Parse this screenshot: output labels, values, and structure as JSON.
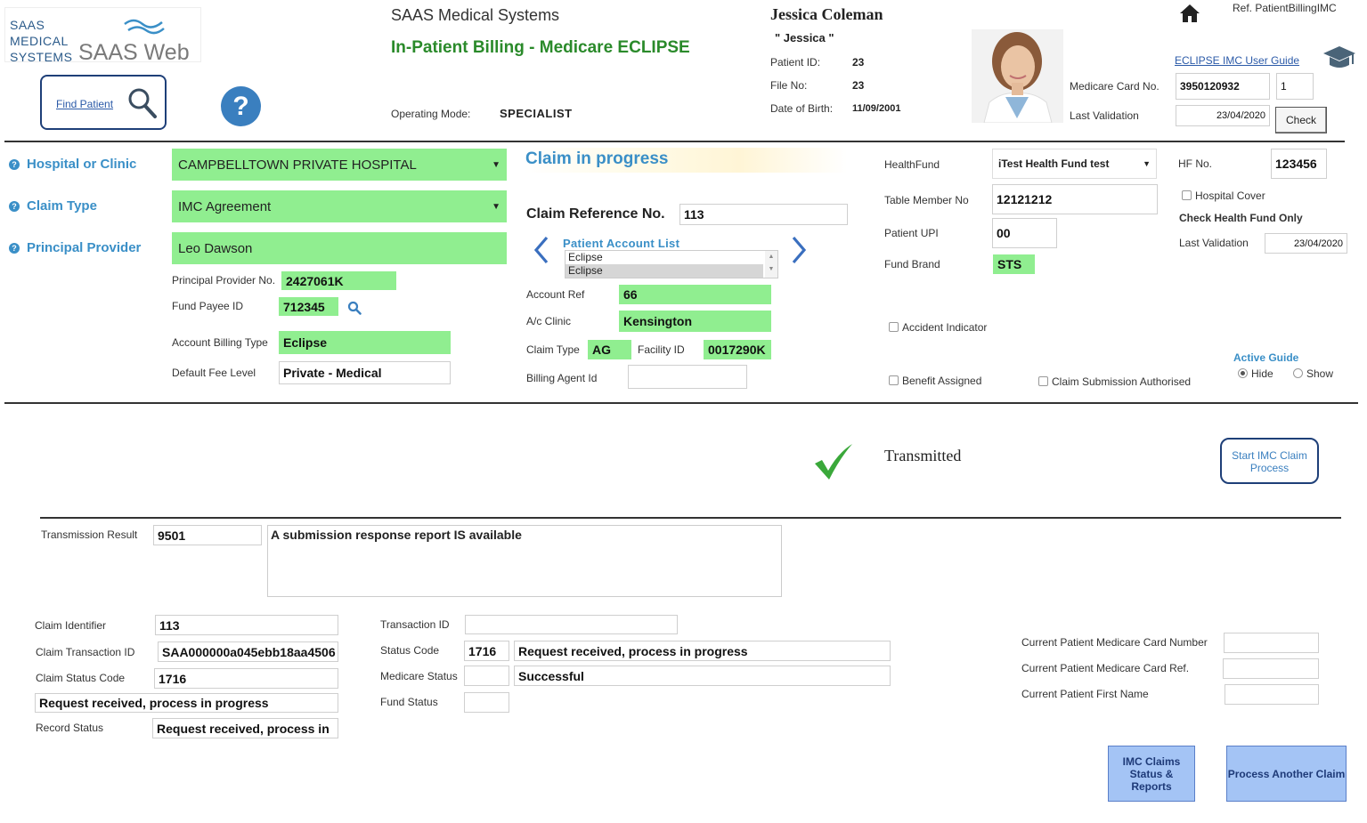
{
  "logo": {
    "line1": "SAAS",
    "line2": "MEDICAL",
    "line3": "SYSTEMS",
    "web": "SAAS Web"
  },
  "header": {
    "company": "SAAS Medical Systems",
    "title": "In-Patient Billing - Medicare ECLIPSE",
    "operating_mode_label": "Operating Mode:",
    "operating_mode": "SPECIALIST",
    "ref": "Ref. PatientBillingIMC",
    "guide_link": "ECLIPSE IMC User Guide"
  },
  "find_patient": {
    "label": "Find Patient"
  },
  "help": {
    "glyph": "?"
  },
  "patient": {
    "name": "Jessica Coleman",
    "nickname": "\" Jessica \"",
    "id_label": "Patient ID:",
    "id": "23",
    "file_label": "File No:",
    "file": "23",
    "dob_label": "Date of Birth:",
    "dob": "11/09/2001"
  },
  "medicare": {
    "card_label": "Medicare Card No.",
    "card": "3950120932",
    "card_ref": "1",
    "validation_label": "Last Validation",
    "validation": "23/04/2020",
    "check_label": "Check"
  },
  "left": {
    "hospital_label": "Hospital or Clinic",
    "hospital": "CAMPBELLTOWN PRIVATE HOSPITAL",
    "claim_type_label": "Claim Type",
    "claim_type": "IMC Agreement",
    "provider_label": "Principal Provider",
    "provider": "Leo Dawson",
    "provider_no_label": "Principal Provider No.",
    "provider_no": "2427061K",
    "fund_payee_label": "Fund Payee ID",
    "fund_payee": "712345",
    "billing_type_label": "Account Billing Type",
    "billing_type": "Eclipse",
    "fee_level_label": "Default Fee Level",
    "fee_level": "Private - Medical"
  },
  "claim": {
    "status": "Claim in progress",
    "ref_label": "Claim Reference No.",
    "ref": "113",
    "account_list_label": "Patient Account List",
    "account_list": [
      "Eclipse",
      "Eclipse"
    ],
    "account_ref_label": "Account Ref",
    "account_ref": "66",
    "clinic_label": "A/c Clinic",
    "clinic": "Kensington",
    "claim_type_label": "Claim Type",
    "claim_type": "AG",
    "facility_label": "Facility ID",
    "facility": "0017290K",
    "billing_agent_label": "Billing Agent Id",
    "billing_agent": ""
  },
  "fund": {
    "healthfund_label": "HealthFund",
    "healthfund": "iTest Health Fund test",
    "hf_no_label": "HF No.",
    "hf_no": "123456",
    "table_member_label": "Table Member No",
    "table_member": "12121212",
    "hospital_cover_label": "Hospital Cover",
    "check_only_label": "Check Health Fund Only",
    "upi_label": "Patient UPI",
    "upi": "00",
    "last_validation_label": "Last Validation",
    "last_validation": "23/04/2020",
    "brand_label": "Fund Brand",
    "brand": "STS",
    "accident_label": "Accident Indicator",
    "benefit_label": "Benefit Assigned",
    "submission_label": "Claim Submission Authorised",
    "active_guide_label": "Active Guide",
    "hide_label": "Hide",
    "show_label": "Show"
  },
  "transmit": {
    "status": "Transmitted",
    "start_button": "Start IMC Claim Process"
  },
  "result": {
    "label": "Transmission Result",
    "code": "9501",
    "message": "A submission response report IS available"
  },
  "details": {
    "claim_id_label": "Claim Identifier",
    "claim_id": "113",
    "claim_txn_label": "Claim Transaction ID",
    "claim_txn": "SAA000000a045ebb18aa4506",
    "claim_status_label": "Claim Status Code",
    "claim_status": "1716",
    "claim_status_text": "Request received, process in progress",
    "record_status_label": "Record Status",
    "record_status": "Request received, process in",
    "txn_id_label": "Transaction ID",
    "txn_id": "",
    "status_code_label": "Status Code",
    "status_code": "1716",
    "status_code_text": "Request received, process in progress",
    "medicare_status_label": "Medicare Status",
    "medicare_status": "",
    "medicare_status_text": "Successful",
    "fund_status_label": "Fund Status",
    "fund_status": ""
  },
  "current": {
    "card_number_label": "Current Patient Medicare Card Number",
    "card_ref_label": "Current Patient Medicare Card Ref.",
    "first_name_label": "Current Patient First Name"
  },
  "actions": {
    "reports": "IMC Claims Status & Reports",
    "another": "Process Another Claim"
  }
}
